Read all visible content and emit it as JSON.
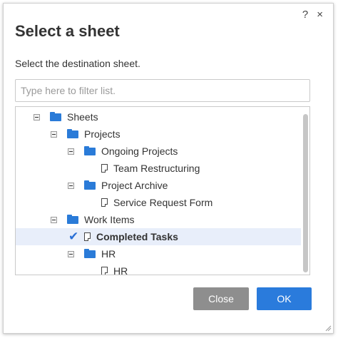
{
  "dialog": {
    "help_icon": "?",
    "close_icon": "×",
    "title": "Select a sheet",
    "subtitle": "Select the destination sheet.",
    "filter_placeholder": "Type here to filter list."
  },
  "tree": {
    "items": [
      {
        "label": "Sheets",
        "type": "folder",
        "level": 0,
        "expanded": true
      },
      {
        "label": "Projects",
        "type": "folder",
        "level": 1,
        "expanded": true
      },
      {
        "label": "Ongoing Projects",
        "type": "folder",
        "level": 2,
        "expanded": true
      },
      {
        "label": "Team Restructuring",
        "type": "sheet",
        "level": 3
      },
      {
        "label": "Project Archive",
        "type": "folder",
        "level": 2,
        "expanded": true
      },
      {
        "label": "Service Request Form",
        "type": "sheet",
        "level": 3
      },
      {
        "label": "Work Items",
        "type": "folder",
        "level": 1,
        "expanded": true
      },
      {
        "label": "Completed Tasks",
        "type": "sheet",
        "level": 2,
        "selected": true
      },
      {
        "label": "HR",
        "type": "folder",
        "level": 2,
        "expanded": true
      },
      {
        "label": "HR",
        "type": "sheet",
        "level": 3
      }
    ]
  },
  "buttons": {
    "close_label": "Close",
    "ok_label": "OK"
  },
  "colors": {
    "accent": "#2a7bdc",
    "folder": "#2a7bd8",
    "selected_row": "#e8eefa",
    "close_button": "#8e8e8e"
  }
}
